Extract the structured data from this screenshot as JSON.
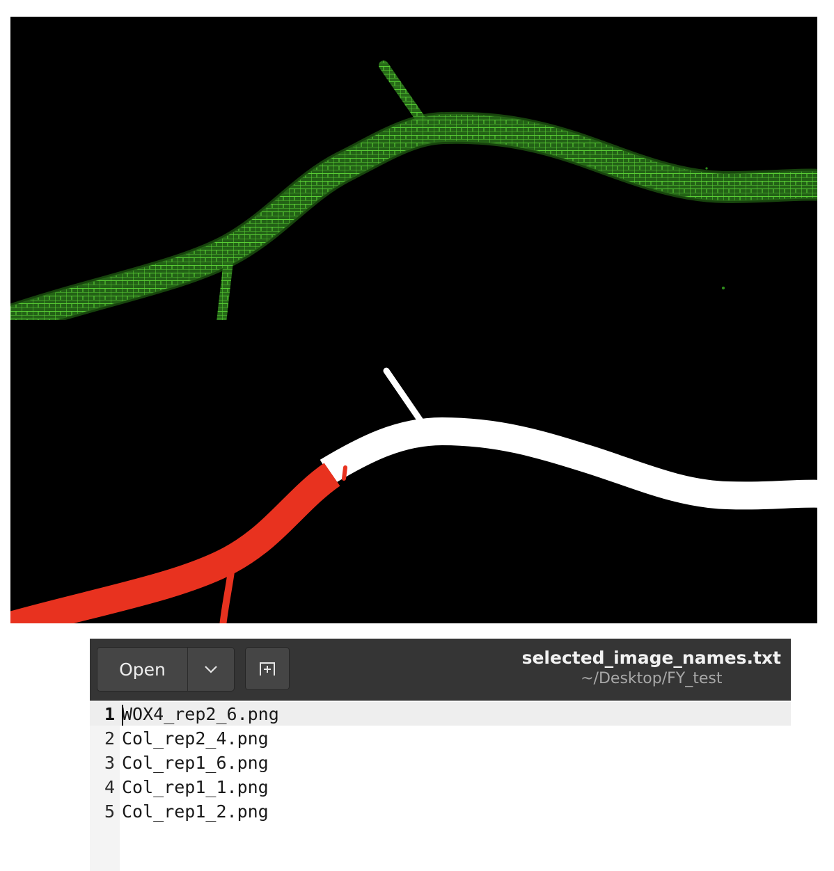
{
  "images": {
    "fluorescence": {
      "label": "root-fluorescence-micrograph",
      "color": "#4bbf2a"
    },
    "segmentation": {
      "label": "root-segmentation-mask",
      "selected_color": "#e8321f",
      "other_color": "#ffffff"
    }
  },
  "editor": {
    "toolbar": {
      "open_label": "Open",
      "open_menu_icon": "chevron-down-icon",
      "new_tab_icon": "new-tab-icon"
    },
    "title": "selected_image_names.txt",
    "path": "~/Desktop/FY_test",
    "current_line": 1,
    "lines": [
      {
        "number": "1",
        "text": "WOX4_rep2_6.png"
      },
      {
        "number": "2",
        "text": "Col_rep2_4.png"
      },
      {
        "number": "3",
        "text": "Col_rep1_6.png"
      },
      {
        "number": "4",
        "text": "Col_rep1_1.png"
      },
      {
        "number": "5",
        "text": "Col_rep1_2.png"
      }
    ]
  }
}
